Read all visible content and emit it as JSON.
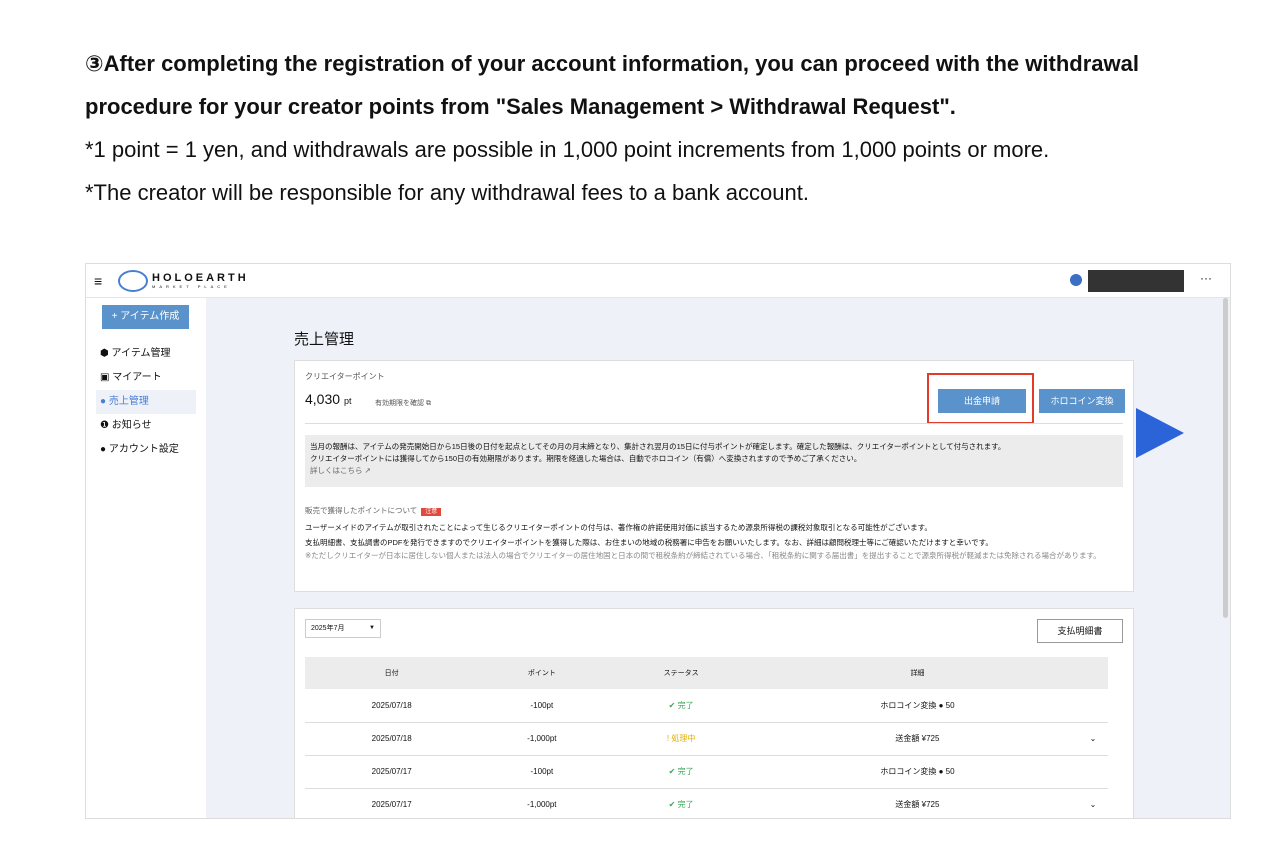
{
  "intro": {
    "line1": "③After completing the registration of your account information, you can proceed with the withdrawal procedure for your creator points from \"Sales Management > Withdrawal Request\".",
    "line2": "*1 point = 1 yen, and withdrawals are possible in 1,000 point increments from 1,000 points or more.",
    "line3": "*The creator will be responsible for any withdrawal fees to a bank account."
  },
  "app": {
    "logo": "HOLOEARTH",
    "logo_sub": "MARKET PLACE",
    "menu_icon": "≡",
    "more_icon": "···"
  },
  "sidebar": {
    "create": "+ アイテム作成",
    "items": [
      {
        "icon": "⬢",
        "label": "アイテム管理"
      },
      {
        "icon": "▣",
        "label": "マイアート"
      },
      {
        "icon": "●",
        "label": "売上管理"
      },
      {
        "icon": "❶",
        "label": "お知らせ"
      },
      {
        "icon": "●",
        "label": "アカウント設定"
      }
    ]
  },
  "page": {
    "title": "売上管理"
  },
  "points": {
    "label": "クリエイターポイント",
    "value": "4,030",
    "unit": "pt",
    "expiry": "有効期限を確認 ⧉",
    "withdraw": "出金申請",
    "convert": "ホロコイン変換"
  },
  "info": {
    "l1": "当月の報酬は、アイテムの発売開始日から15日後の日付を起点としてその月の月末締となり、集計され翌月の15日に付与ポイントが確定します。確定した報酬は、クリエイターポイントとして付与されます。",
    "l2": "クリエイターポイントには獲得してから150日の有効期限があります。期限を経過した場合は、自動でホロコイン（有償）へ変換されますので予めご了承ください。",
    "link": "詳しくはこちら ↗"
  },
  "notice": {
    "title": "販売で獲得したポイントについて",
    "tag": "注意",
    "p1": "ユーザーメイドのアイテムが取引されたことによって生じるクリエイターポイントの付与は、著作権の許諾使用対価に該当するため源泉所得税の課税対象取引となる可能性がございます。",
    "p2": "支払明細書、支払調書のPDFを発行できますのでクリエイターポイントを獲得した際は、お住まいの地域の税務署に申告をお願いいたします。なお、詳細は顧問税理士等にご確認いただけますと幸いです。",
    "p3": "※ただしクリエイターが日本に居住しない個人または法人の場合でクリエイターの居住地国と日本の間で租税条約が締結されている場合、「租税条約に関する届出書」を提出することで源泉所得税が軽減または免除される場合があります。"
  },
  "history": {
    "month": "2025年7月",
    "statement": "支払明細書",
    "headers": [
      "日付",
      "ポイント",
      "ステータス",
      "詳細"
    ],
    "rows": [
      {
        "date": "2025/07/18",
        "points": "-100pt",
        "status": "✔ 完了",
        "detail": "ホロコイン変換 ● 50",
        "chev": ""
      },
      {
        "date": "2025/07/18",
        "points": "-1,000pt",
        "status": "! 処理中",
        "detail": "送金額 ¥725",
        "chev": "⌄"
      },
      {
        "date": "2025/07/17",
        "points": "-100pt",
        "status": "✔ 完了",
        "detail": "ホロコイン変換 ● 50",
        "chev": ""
      },
      {
        "date": "2025/07/17",
        "points": "-1,000pt",
        "status": "✔ 完了",
        "detail": "送金額 ¥725",
        "chev": "⌄"
      }
    ]
  }
}
